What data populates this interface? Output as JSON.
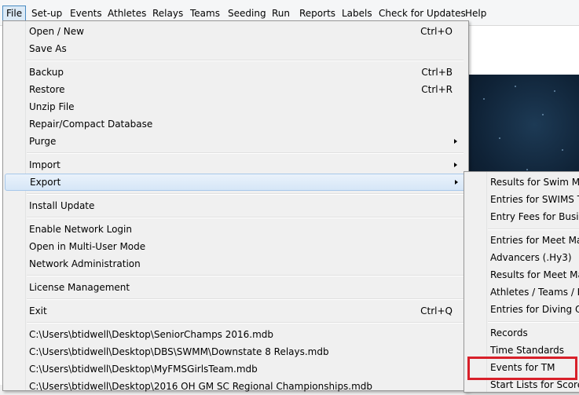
{
  "menubar": {
    "items": [
      "File",
      "Set-up",
      "Events",
      "Athletes",
      "Relays",
      "Teams",
      "Seeding",
      "Run",
      "Reports",
      "Labels",
      "Check for Updates",
      "Help"
    ]
  },
  "file_menu": {
    "open_new": {
      "label": "Open / New",
      "shortcut": "Ctrl+O"
    },
    "save_as": {
      "label": "Save As"
    },
    "backup": {
      "label": "Backup",
      "shortcut": "Ctrl+B"
    },
    "restore": {
      "label": "Restore",
      "shortcut": "Ctrl+R"
    },
    "unzip": {
      "label": "Unzip File"
    },
    "repair": {
      "label": "Repair/Compact Database"
    },
    "purge": {
      "label": "Purge"
    },
    "import": {
      "label": "Import"
    },
    "export": {
      "label": "Export"
    },
    "install_update": {
      "label": "Install Update"
    },
    "enable_network": {
      "label": "Enable Network Login"
    },
    "multi_user": {
      "label": "Open in Multi-User Mode"
    },
    "network_admin": {
      "label": "Network Administration"
    },
    "license": {
      "label": "License Management"
    },
    "exit": {
      "label": "Exit",
      "shortcut": "Ctrl+Q"
    },
    "recent": [
      "C:\\Users\\btidwell\\Desktop\\SeniorChamps 2016.mdb",
      "C:\\Users\\btidwell\\Desktop\\DBS\\SWMM\\Downstate 8 Relays.mdb",
      "C:\\Users\\btidwell\\Desktop\\MyFMSGirlsTeam.mdb",
      "C:\\Users\\btidwell\\Desktop\\2016 OH GM SC Regional Championships.mdb"
    ]
  },
  "export_submenu": {
    "items": [
      "Results for Swim Mana",
      "Entries for SWIMS Tim",
      "Entry Fees for Busines",
      "Entries for Meet Mana",
      "Advancers   (.Hy3)",
      "Results for Meet Mana",
      "Athletes / Teams / En",
      "Entries for Diving Only",
      "Records",
      "Time Standards",
      "Events for TM",
      "Start Lists for Scorebo"
    ]
  },
  "colors": {
    "highlight_box": "#d8202a",
    "menu_hover": "#d6e6f7"
  }
}
